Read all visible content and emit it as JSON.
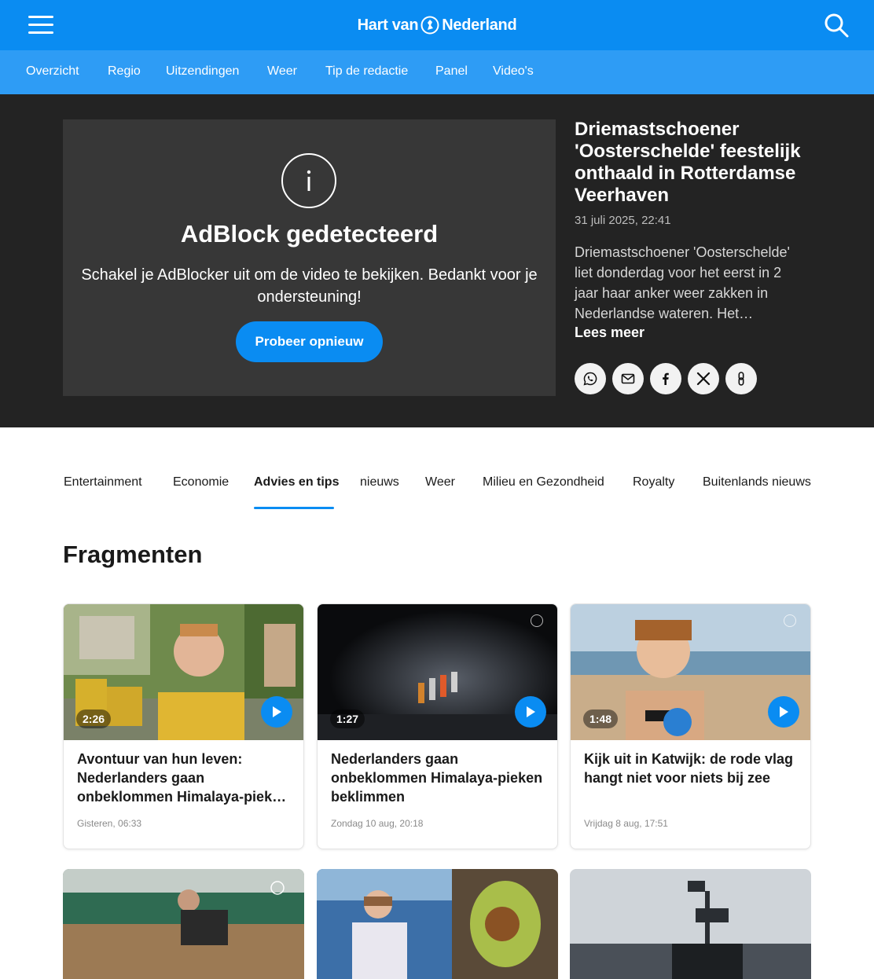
{
  "header": {
    "logo_left": "Hart van",
    "logo_right": "Nederland",
    "colors": {
      "brand": "#0a8cf2",
      "subnav": "#2e9cf5"
    }
  },
  "nav": [
    {
      "label": "Overzicht"
    },
    {
      "label": "Regio"
    },
    {
      "label": "Uitzendingen"
    },
    {
      "label": "Weer"
    },
    {
      "label": "Tip de redactie"
    },
    {
      "label": "Panel"
    },
    {
      "label": "Video's"
    }
  ],
  "player": {
    "title": "AdBlock gedetecteerd",
    "message": "Schakel je AdBlocker uit om de video te bekijken. Bedankt voor je ondersteuning!",
    "retry_label": "Probeer opnieuw"
  },
  "article": {
    "title": "Driemastschoener 'Oosterschelde' feestelijk onthaald in Rotterdamse Veerhaven",
    "date": "31 juli 2025, 22:41",
    "description": "Driemastschoener 'Oosterschelde' liet donderdag voor het eerst in 2 jaar haar anker weer zakken in Nederlandse wateren. Het…",
    "read_more": "Lees meer",
    "share_icons": [
      "whatsapp-icon",
      "mail-icon",
      "facebook-icon",
      "x-icon",
      "link-icon"
    ]
  },
  "categories": [
    {
      "label": "Entertainment",
      "active": false
    },
    {
      "label": "Economie",
      "active": false
    },
    {
      "label": "Advies en tips",
      "active": true
    },
    {
      "label": "nieuws",
      "active": false
    },
    {
      "label": "Weer",
      "active": false
    },
    {
      "label": "Milieu en Gezondheid",
      "active": false
    },
    {
      "label": "Royalty",
      "active": false
    },
    {
      "label": "Buitenlands nieuws",
      "active": false
    }
  ],
  "section_title": "Fragmenten",
  "fragments": [
    {
      "duration": "2:26",
      "title": "Avontuur van hun leven: Nederlanders gaan onbeklommen Himalaya-pieken beklimmen",
      "date": "Gisteren, 06:33"
    },
    {
      "duration": "1:27",
      "title": "Nederlanders gaan onbeklommen Himalaya-pieken beklimmen",
      "date": "Zondag 10 aug, 20:18"
    },
    {
      "duration": "1:48",
      "title": "Kijk uit in Katwijk: de rode vlag hangt niet voor niets bij zee",
      "date": "Vrijdag 8 aug, 17:51"
    }
  ]
}
